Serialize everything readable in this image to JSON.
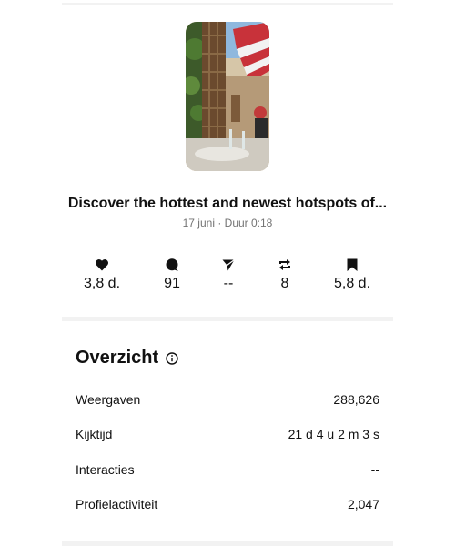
{
  "reel": {
    "title": "Discover the hottest and newest hotspots of...",
    "meta": "17 juni · Duur 0:18"
  },
  "stats": [
    {
      "icon": "heart-icon",
      "value": "3,8 d."
    },
    {
      "icon": "comment-icon",
      "value": "91"
    },
    {
      "icon": "share-icon",
      "value": "--"
    },
    {
      "icon": "repost-icon",
      "value": "8"
    },
    {
      "icon": "bookmark-icon",
      "value": "5,8 d."
    }
  ],
  "overview": {
    "title": "Overzicht",
    "rows": [
      {
        "label": "Weergaven",
        "value": "288,626"
      },
      {
        "label": "Kijktijd",
        "value": "21 d 4 u 2 m 3 s"
      },
      {
        "label": "Interacties",
        "value": "--"
      },
      {
        "label": "Profielactiviteit",
        "value": "2,047"
      }
    ]
  },
  "colors": {
    "text": "#111111",
    "muted": "#737373",
    "divider": "#f2f2f2"
  }
}
